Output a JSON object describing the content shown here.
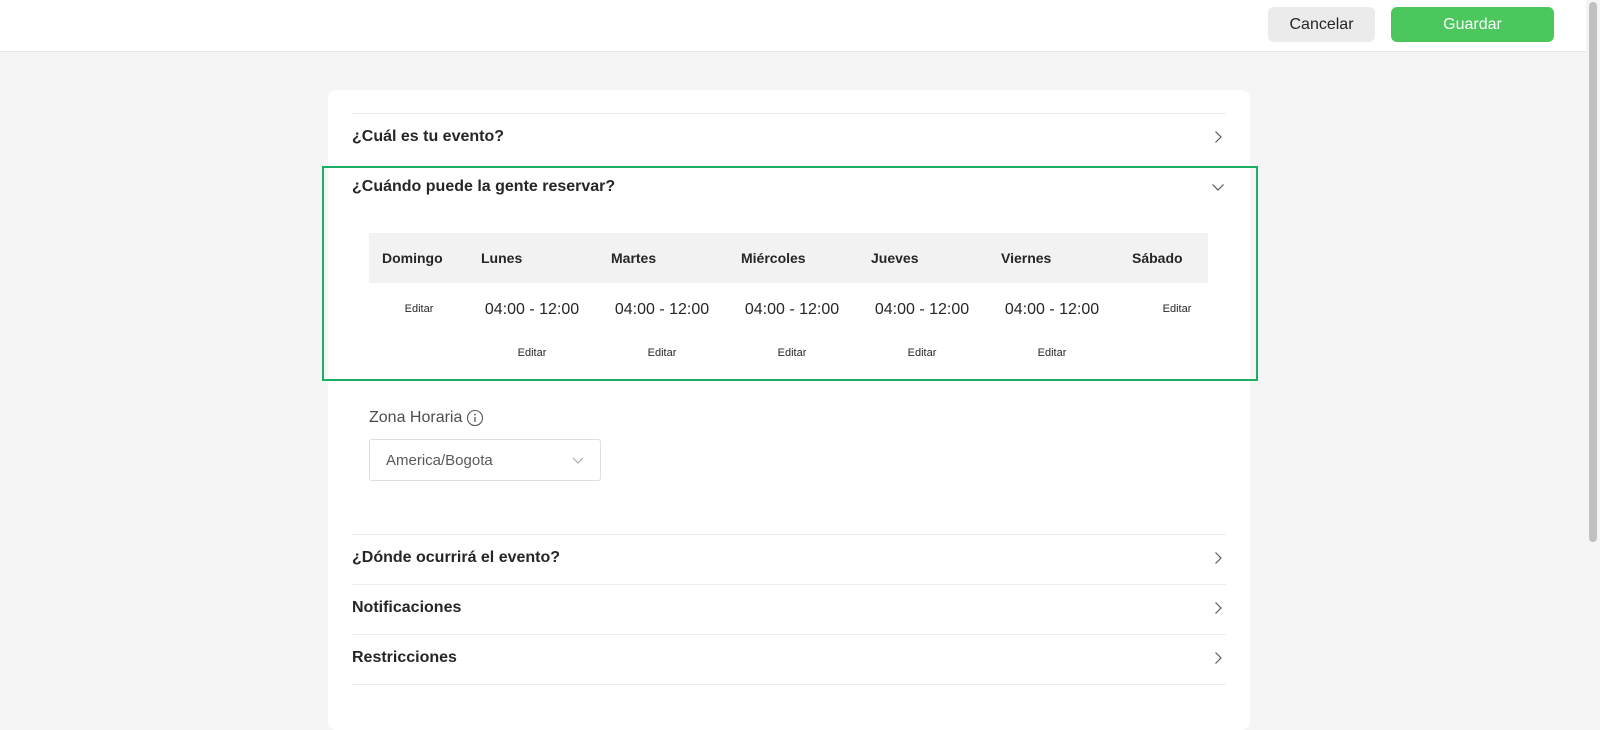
{
  "toolbar": {
    "cancel_label": "Cancelar",
    "save_label": "Guardar"
  },
  "sections": {
    "event": "¿Cuál es tu evento?",
    "when": "¿Cuándo puede la gente reservar?",
    "where": "¿Dónde ocurrirá el evento?",
    "notifications": "Notificaciones",
    "restrictions": "Restricciones"
  },
  "schedule": {
    "days": [
      "Domingo",
      "Lunes",
      "Martes",
      "Miércoles",
      "Jueves",
      "Viernes",
      "Sábado"
    ],
    "times": [
      "",
      "04:00 - 12:00",
      "04:00 - 12:00",
      "04:00 - 12:00",
      "04:00 - 12:00",
      "04:00 - 12:00",
      ""
    ],
    "edit_label": "Editar"
  },
  "timezone": {
    "label": "Zona Horaria",
    "value": "America/Bogota"
  },
  "colors": {
    "accent": "#4cc75d",
    "highlight": "#1cae62"
  }
}
